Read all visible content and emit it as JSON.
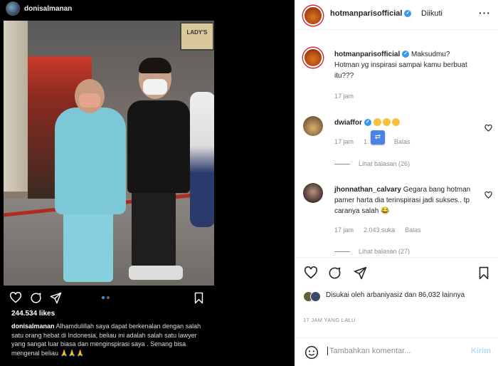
{
  "left": {
    "username": "donisalmanan",
    "photo_sign": "LADY'S",
    "likes": "244.534 likes",
    "caption_user": "donisalmanan",
    "caption_text": "Alhamdulillah saya dapat berkenalan dengan salah satu orang hebat di Indonesia, beliau ini adalah salah satu lawyer yang sangat luar biasa dan menginspirasi saya . Senang bisa mengenal beliau 🙏🙏🙏"
  },
  "right": {
    "header": {
      "username": "hotmanparisofficial",
      "follow_label": "Diikuti",
      "more": "···"
    },
    "comments": [
      {
        "user": "hotmanparisofficial",
        "text": "Maksudmu? Hotman yg inspirasi sampai kamu berbuat itu???",
        "time": "17 jam"
      },
      {
        "user": "dwiaffor",
        "text": "😂😂😂",
        "time": "17 jam",
        "likes": "1.⁠⁠ suka",
        "reply": "Balas",
        "view_replies": "Lihat balasan (26)"
      },
      {
        "user": "jhonnathan_calvary",
        "text": "Gegara bang hotman pamer harta dia terinspirasi jadi sukses.. tp caranya salah 😂",
        "time": "17 jam",
        "likes": "2.043 suka",
        "reply": "Balas",
        "view_replies": "Lihat balasan (27)"
      }
    ],
    "liked_by": "Disukai oleh arbaniyasiz dan 86,032 lainnya",
    "time_ago": "17 JAM YANG LALU",
    "add_comment_placeholder": "Tambahkan komentar...",
    "send_label": "Kirim"
  },
  "colors": {
    "accent": "#3897f0",
    "bg_dark": "#000000",
    "text_muted": "#8e8e8e"
  }
}
